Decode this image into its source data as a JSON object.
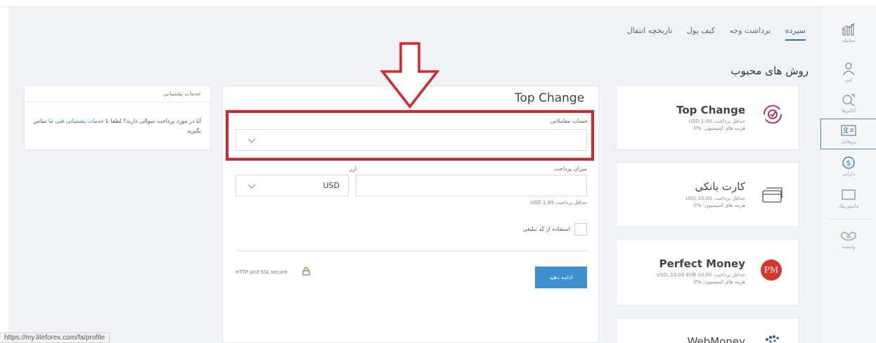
{
  "sidebar": {
    "items": [
      {
        "label": "معامله",
        "icon": "chart-icon"
      },
      {
        "label": "کپی",
        "icon": "copy-trader-icon"
      },
      {
        "label": "آنالیزها",
        "icon": "analytics-icon"
      },
      {
        "label": "پروفایل",
        "icon": "profile-card-icon",
        "active": true
      },
      {
        "label": "دارایی",
        "icon": "dollar-coin-icon"
      },
      {
        "label": "مانیتورینگ",
        "icon": "monitor-icon"
      },
      {
        "label": "وابسته",
        "icon": "handshake-icon"
      }
    ]
  },
  "tabs": [
    {
      "label": "سپرده",
      "active": true
    },
    {
      "label": "برداشت وجه"
    },
    {
      "label": "کیف پول"
    },
    {
      "label": "تاریخچه انتقال"
    }
  ],
  "section_title": "روش های محبوب",
  "methods": [
    {
      "name": "Top Change",
      "min": "حداقل پرداخت: USD 1.00",
      "fee": "هزینه های کمیسیون: %0",
      "icon": "top-change-icon"
    },
    {
      "name": "کارت بانکی",
      "min": "حداقل پرداخت: USD 10.00",
      "fee": "هزینه های کمیسیون: %0",
      "icon": "bank-card-icon"
    },
    {
      "name": "Perfect Money",
      "min": "حداقل پرداخت: 10.00 USD, 10.00 EUR",
      "fee": "هزینه های کمیسیون: %0",
      "icon": "perfect-money-icon",
      "icon_text": "PM"
    },
    {
      "name": "WebMoney",
      "icon": "webmoney-icon"
    }
  ],
  "form": {
    "title": "Top Change",
    "account_label": "حساب معاملاتی",
    "account_value": "",
    "amount_label": "میزان پرداخت",
    "amount_value": "",
    "currency_label": "ارز",
    "currency_value": "USD",
    "min_hint": "حداقل پرداخت: USD 1.00",
    "promo_label": "استفاده از کد تبلیغی",
    "continue_label": "ادامه دهید",
    "secure_text": "HTTP and SSL secure"
  },
  "support": {
    "title": "خدمات پشتیبانی",
    "text": "آیا در مورد پرداخت سوالی دارید؟ لطفا با ",
    "link": "خدمات پشتیبانی فنی ما",
    "text_end": " تماس بگیرید"
  },
  "status_url": "https://my.liteforex.com/fa/profile",
  "colors": {
    "accent": "#2a6fa8",
    "highlight_box": "#d9252a",
    "button": "#3c8fd0",
    "pm_red": "#d7362b"
  }
}
